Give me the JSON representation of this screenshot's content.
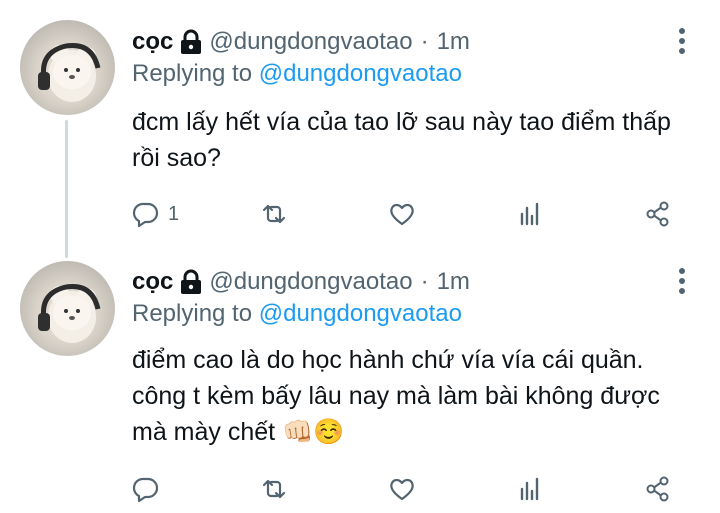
{
  "tweets": [
    {
      "name": "cọc",
      "handle": "@dungdongvaotao",
      "separator": "·",
      "time": "1m",
      "replying_label": "Replying to",
      "replying_handle": "@dungdongvaotao",
      "text_lines": [
        "đcm lấy hết vía của tao lỡ sau này tao điểm thấp",
        "rồi sao?"
      ],
      "reply_count": "1",
      "icons": [
        "lock-icon",
        "more-icon",
        "reply-icon",
        "retweet-icon",
        "like-icon",
        "views-icon",
        "share-icon"
      ]
    },
    {
      "name": "cọc",
      "handle": "@dungdongvaotao",
      "separator": "·",
      "time": "1m",
      "replying_label": "Replying to",
      "replying_handle": "@dungdongvaotao",
      "text_lines": [
        "điểm cao là do học hành chứ vía vía cái quần.",
        "công t kèm bấy lâu nay mà làm bài không được",
        "mà mày chết 👊🏻☺️"
      ],
      "reply_count": "",
      "icons": [
        "lock-icon",
        "more-icon",
        "reply-icon",
        "retweet-icon",
        "like-icon",
        "views-icon",
        "share-icon"
      ]
    }
  ],
  "colors": {
    "text": "#0f1419",
    "secondary": "#536471",
    "link": "#1d9bf0",
    "thread_line": "#cfd9de"
  }
}
